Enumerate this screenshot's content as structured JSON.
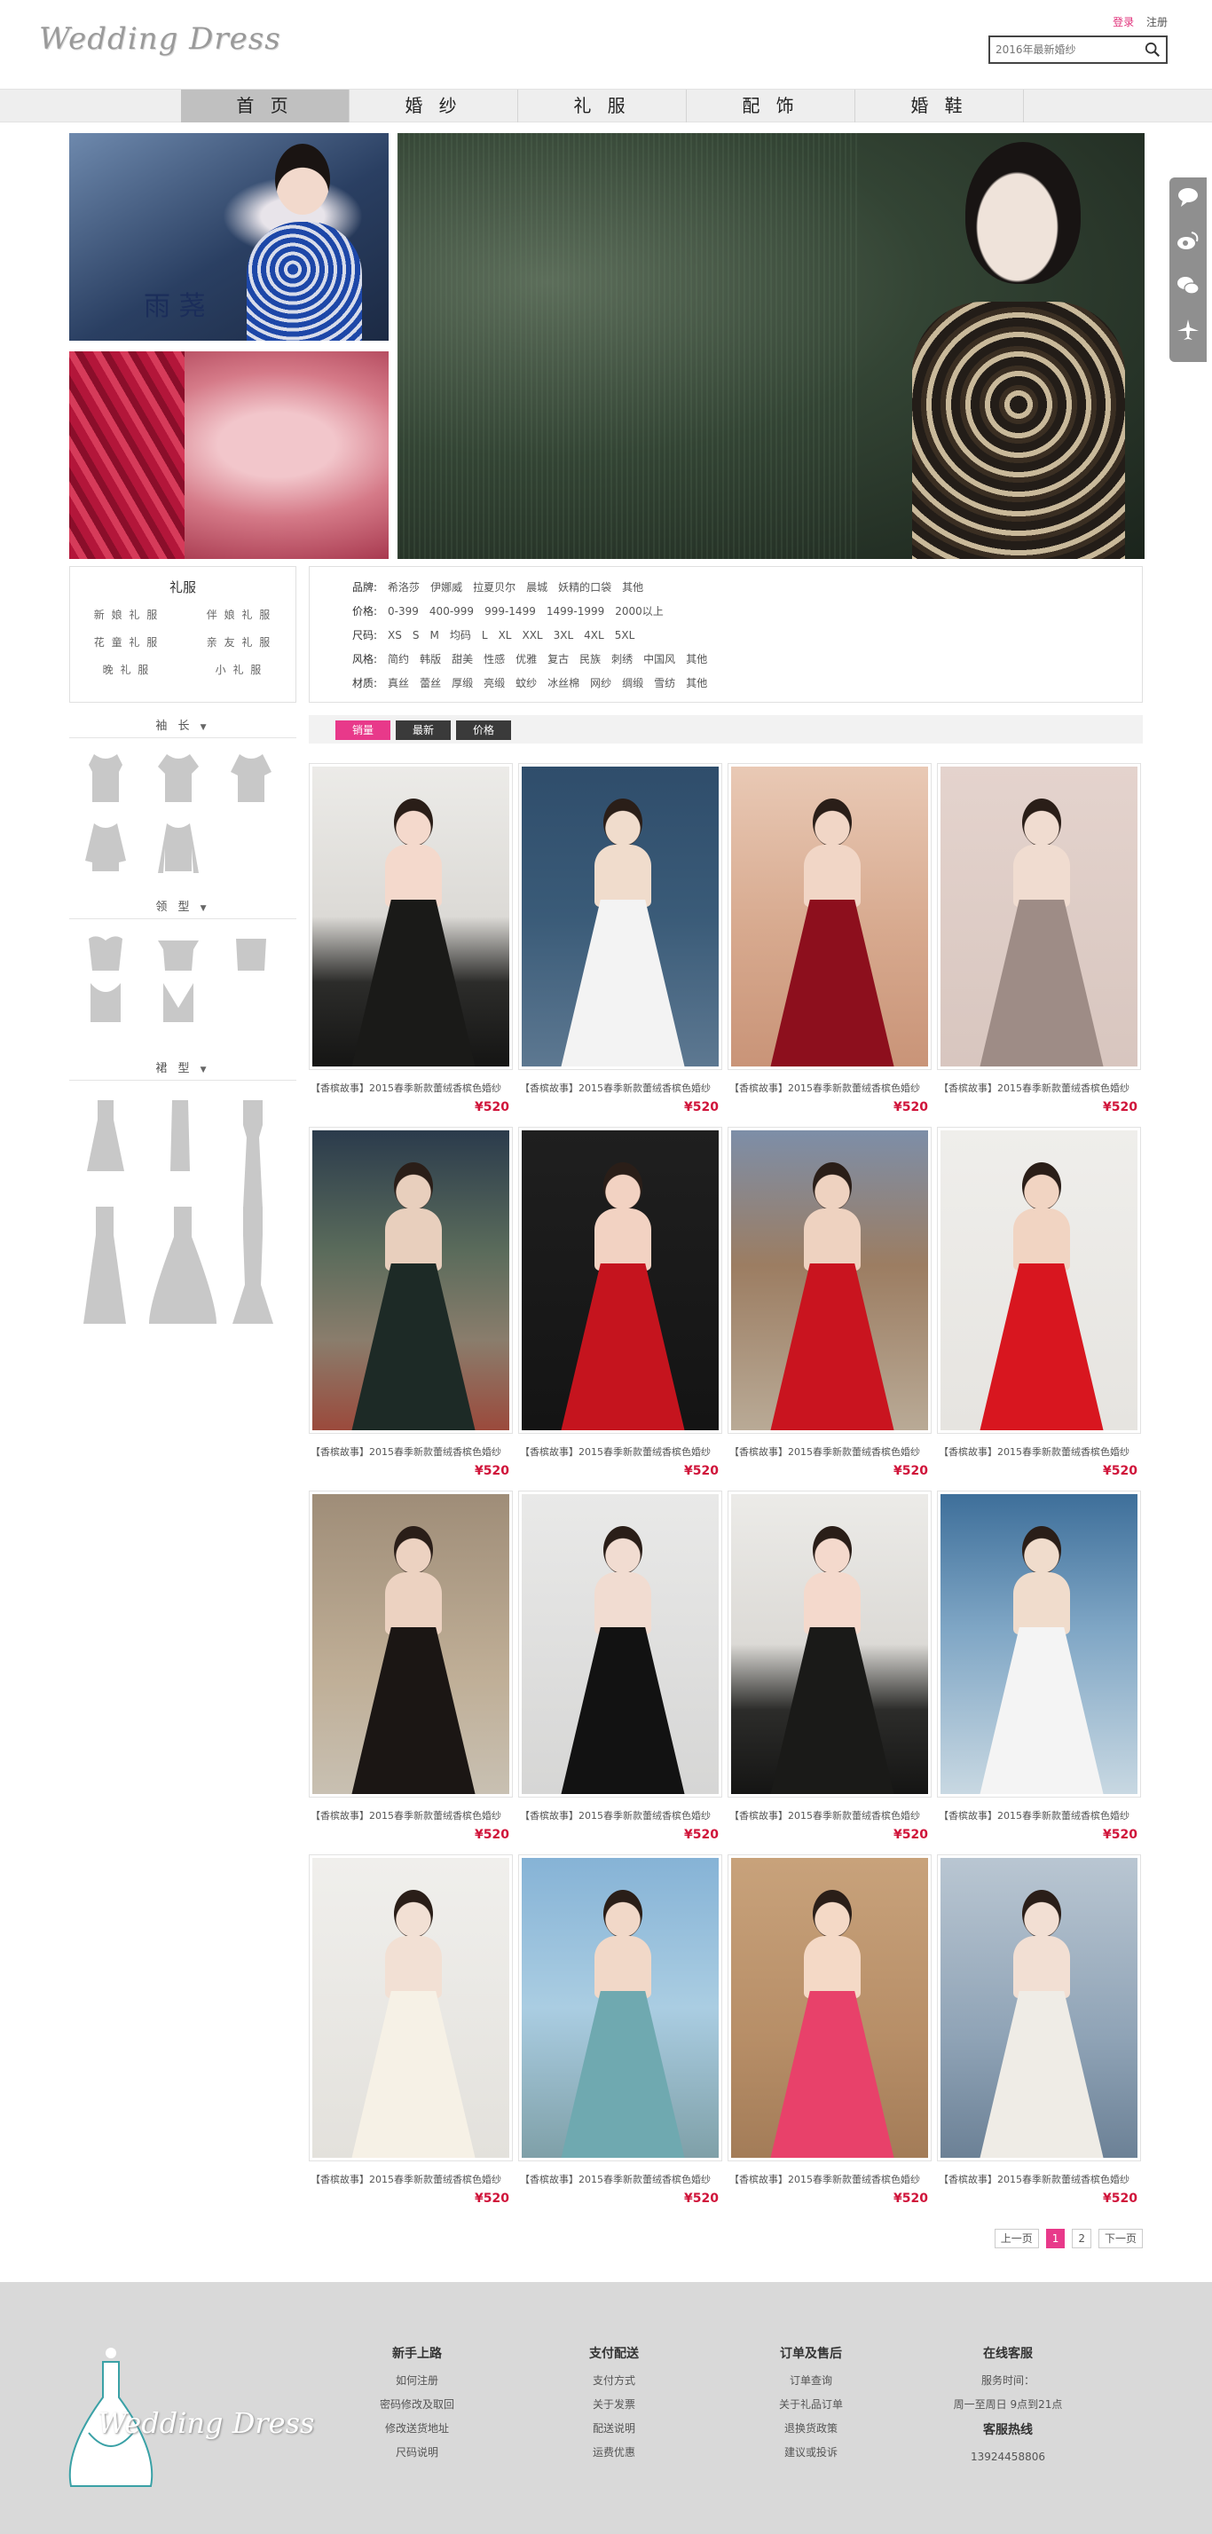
{
  "header": {
    "logo": "Wedding Dress",
    "login": "登录",
    "register": "注册",
    "search_placeholder": "2016年最新婚纱"
  },
  "nav": [
    {
      "label": "首 页",
      "active": true
    },
    {
      "label": "婚 纱",
      "active": false
    },
    {
      "label": "礼 服",
      "active": false
    },
    {
      "label": "配 饰",
      "active": false
    },
    {
      "label": "婚 鞋",
      "active": false
    }
  ],
  "banner": {
    "small1_calligraphy": "雨 荛"
  },
  "category": {
    "title": "礼服",
    "items": [
      "新 娘 礼 服",
      "伴 娘 礼 服",
      "花 童 礼 服",
      "亲 友 礼 服",
      "晚 礼 服",
      "小 礼 服"
    ]
  },
  "shape_sections": {
    "sleeve": "袖 长",
    "collar": "领 型",
    "skirt": "裙 型"
  },
  "filters": [
    {
      "label": "品牌:",
      "options": [
        "希洛莎",
        "伊娜威",
        "拉夏贝尔",
        "晨城",
        "妖精的口袋",
        "其他"
      ]
    },
    {
      "label": "价格:",
      "options": [
        "0-399",
        "400-999",
        "999-1499",
        "1499-1999",
        "2000以上"
      ]
    },
    {
      "label": "尺码:",
      "options": [
        "XS",
        "S",
        "M",
        "均码",
        "L",
        "XL",
        "XXL",
        "3XL",
        "4XL",
        "5XL"
      ]
    },
    {
      "label": "风格:",
      "options": [
        "简约",
        "韩版",
        "甜美",
        "性感",
        "优雅",
        "复古",
        "民族",
        "刺绣",
        "中国风",
        "其他"
      ]
    },
    {
      "label": "材质:",
      "options": [
        "真丝",
        "蕾丝",
        "厚缎",
        "亮缎",
        "蚊纱",
        "冰丝棉",
        "网纱",
        "绸缎",
        "雪纺",
        "其他"
      ]
    }
  ],
  "sort": [
    "销量",
    "最新",
    "价格"
  ],
  "product_title": "【香槟故事】2015春季新款蕾绒香槟色婚纱",
  "products": [
    {
      "price": "¥520"
    },
    {
      "price": "¥520"
    },
    {
      "price": "¥520"
    },
    {
      "price": "¥520"
    },
    {
      "price": "¥520"
    },
    {
      "price": "¥520"
    },
    {
      "price": "¥520"
    },
    {
      "price": "¥520"
    },
    {
      "price": "¥520"
    },
    {
      "price": "¥520"
    },
    {
      "price": "¥520"
    },
    {
      "price": "¥520"
    },
    {
      "price": "¥520"
    },
    {
      "price": "¥520"
    },
    {
      "price": "¥520"
    },
    {
      "price": "¥520"
    }
  ],
  "pager": {
    "prev": "上一页",
    "pages": [
      "1",
      "2"
    ],
    "current": "1",
    "next": "下一页"
  },
  "footer": {
    "logo": "Wedding Dress",
    "columns": [
      {
        "title": "新手上路",
        "links": [
          "如何注册",
          "密码修改及取回",
          "修改送货地址",
          "尺码说明"
        ]
      },
      {
        "title": "支付配送",
        "links": [
          "支付方式",
          "关于发票",
          "配送说明",
          "运费优惠"
        ]
      },
      {
        "title": "订单及售后",
        "links": [
          "订单查询",
          "关于礼品订单",
          "退换货政策",
          "建议或投诉"
        ]
      }
    ],
    "service": {
      "title": "在线客服",
      "hours_label": "服务时间：",
      "hours": "周一至周日 9点到21点",
      "hotline_title": "客服热线",
      "hotline": "13924458806"
    }
  },
  "social_icons": [
    "chat-icon",
    "weibo-icon",
    "wechat-icon",
    "airplane-icon"
  ],
  "colors": {
    "accent": "#e8398a",
    "price": "#d0143a",
    "nav_bg": "#eeeeee",
    "footer_bg": "#d9d9d9"
  }
}
